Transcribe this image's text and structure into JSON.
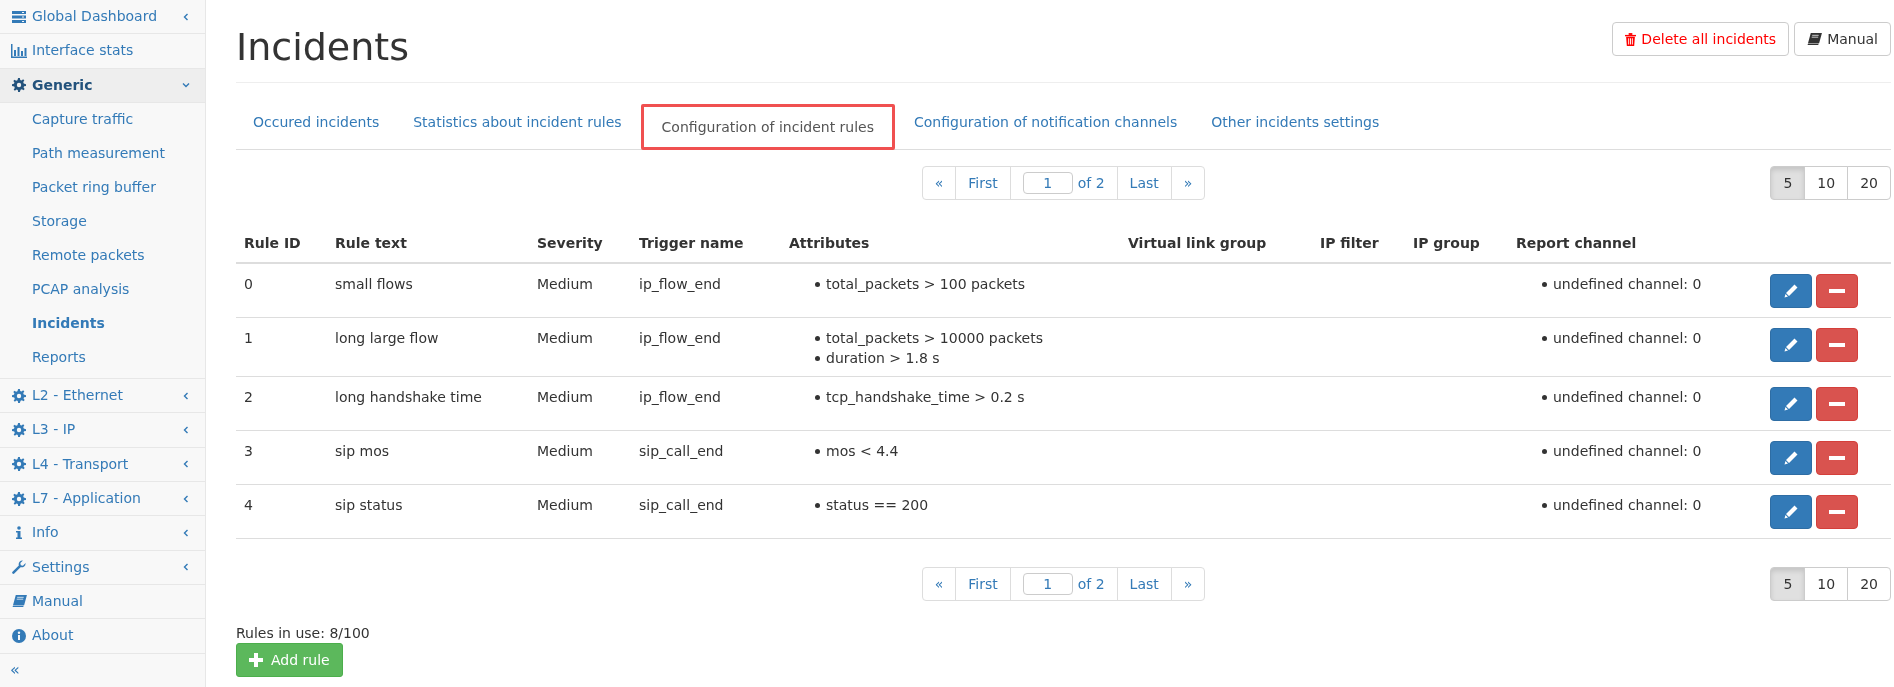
{
  "sidebar": {
    "items": [
      {
        "label": "Global Dashboard",
        "expanded": false
      },
      {
        "label": "Interface stats"
      },
      {
        "label": "Generic",
        "expanded": true,
        "children": [
          {
            "label": "Capture traffic",
            "selected": false
          },
          {
            "label": "Path measurement",
            "selected": false
          },
          {
            "label": "Packet ring buffer",
            "selected": false
          },
          {
            "label": "Storage",
            "selected": false
          },
          {
            "label": "Remote packets",
            "selected": false
          },
          {
            "label": "PCAP analysis",
            "selected": false
          },
          {
            "label": "Incidents",
            "selected": true
          },
          {
            "label": "Reports",
            "selected": false
          }
        ]
      },
      {
        "label": "L2 - Ethernet",
        "expanded": false
      },
      {
        "label": "L3 - IP",
        "expanded": false
      },
      {
        "label": "L4 - Transport",
        "expanded": false
      },
      {
        "label": "L7 - Application",
        "expanded": false
      },
      {
        "label": "Info",
        "expanded": false
      },
      {
        "label": "Settings",
        "expanded": false
      },
      {
        "label": "Manual"
      },
      {
        "label": "About"
      }
    ],
    "collapse": "«"
  },
  "page": {
    "title": "Incidents",
    "buttons": [
      {
        "kind": "danger",
        "label": "Delete all incidents"
      },
      {
        "kind": "default",
        "label": "Manual"
      }
    ]
  },
  "tabs": [
    {
      "label": "Occured incidents",
      "selected": false
    },
    {
      "label": "Statistics about incident rules",
      "selected": false
    },
    {
      "label": "Configuration of incident rules",
      "selected": true
    },
    {
      "label": "Configuration of notification channels",
      "selected": false
    },
    {
      "label": "Other incidents settings",
      "selected": false
    }
  ],
  "pagers": [
    {
      "prev": "«",
      "first": "First",
      "page": "1",
      "of": "of 2",
      "last": "Last",
      "next": "»",
      "sizes": [
        {
          "label": "5",
          "selected": true
        },
        {
          "label": "10",
          "selected": false
        },
        {
          "label": "20",
          "selected": false
        }
      ]
    },
    {
      "prev": "«",
      "first": "First",
      "page": "1",
      "of": "of 2",
      "last": "Last",
      "next": "»",
      "sizes": [
        {
          "label": "5",
          "selected": true
        },
        {
          "label": "10",
          "selected": false
        },
        {
          "label": "20",
          "selected": false
        }
      ]
    }
  ],
  "table": {
    "columns": [
      "Rule ID",
      "Rule text",
      "Severity",
      "Trigger name",
      "Attributes",
      "Virtual link group",
      "IP filter",
      "IP group",
      "Report channel"
    ],
    "rows": [
      {
        "rule_id": "0",
        "rule_text": "small flows",
        "severity": "Medium",
        "trigger": "ip_flow_end",
        "attributes": [
          "total_packets > 100 packets"
        ],
        "report_channel": [
          "undefined channel: 0"
        ]
      },
      {
        "rule_id": "1",
        "rule_text": "long large flow",
        "severity": "Medium",
        "trigger": "ip_flow_end",
        "attributes": [
          "total_packets > 10000 packets",
          "duration > 1.8 s"
        ],
        "report_channel": [
          "undefined channel: 0"
        ]
      },
      {
        "rule_id": "2",
        "rule_text": "long handshake time",
        "severity": "Medium",
        "trigger": "ip_flow_end",
        "attributes": [
          "tcp_handshake_time > 0.2 s"
        ],
        "report_channel": [
          "undefined channel: 0"
        ]
      },
      {
        "rule_id": "3",
        "rule_text": "sip mos",
        "severity": "Medium",
        "trigger": "sip_call_end",
        "attributes": [
          "mos < 4.4"
        ],
        "report_channel": [
          "undefined channel: 0"
        ]
      },
      {
        "rule_id": "4",
        "rule_text": "sip status",
        "severity": "Medium",
        "trigger": "sip_call_end",
        "attributes": [
          "status == 200"
        ],
        "report_channel": [
          "undefined channel: 0"
        ]
      }
    ]
  },
  "footer": {
    "rules_in_use": "Rules in use: 8/100",
    "add_button": "Add rule"
  }
}
